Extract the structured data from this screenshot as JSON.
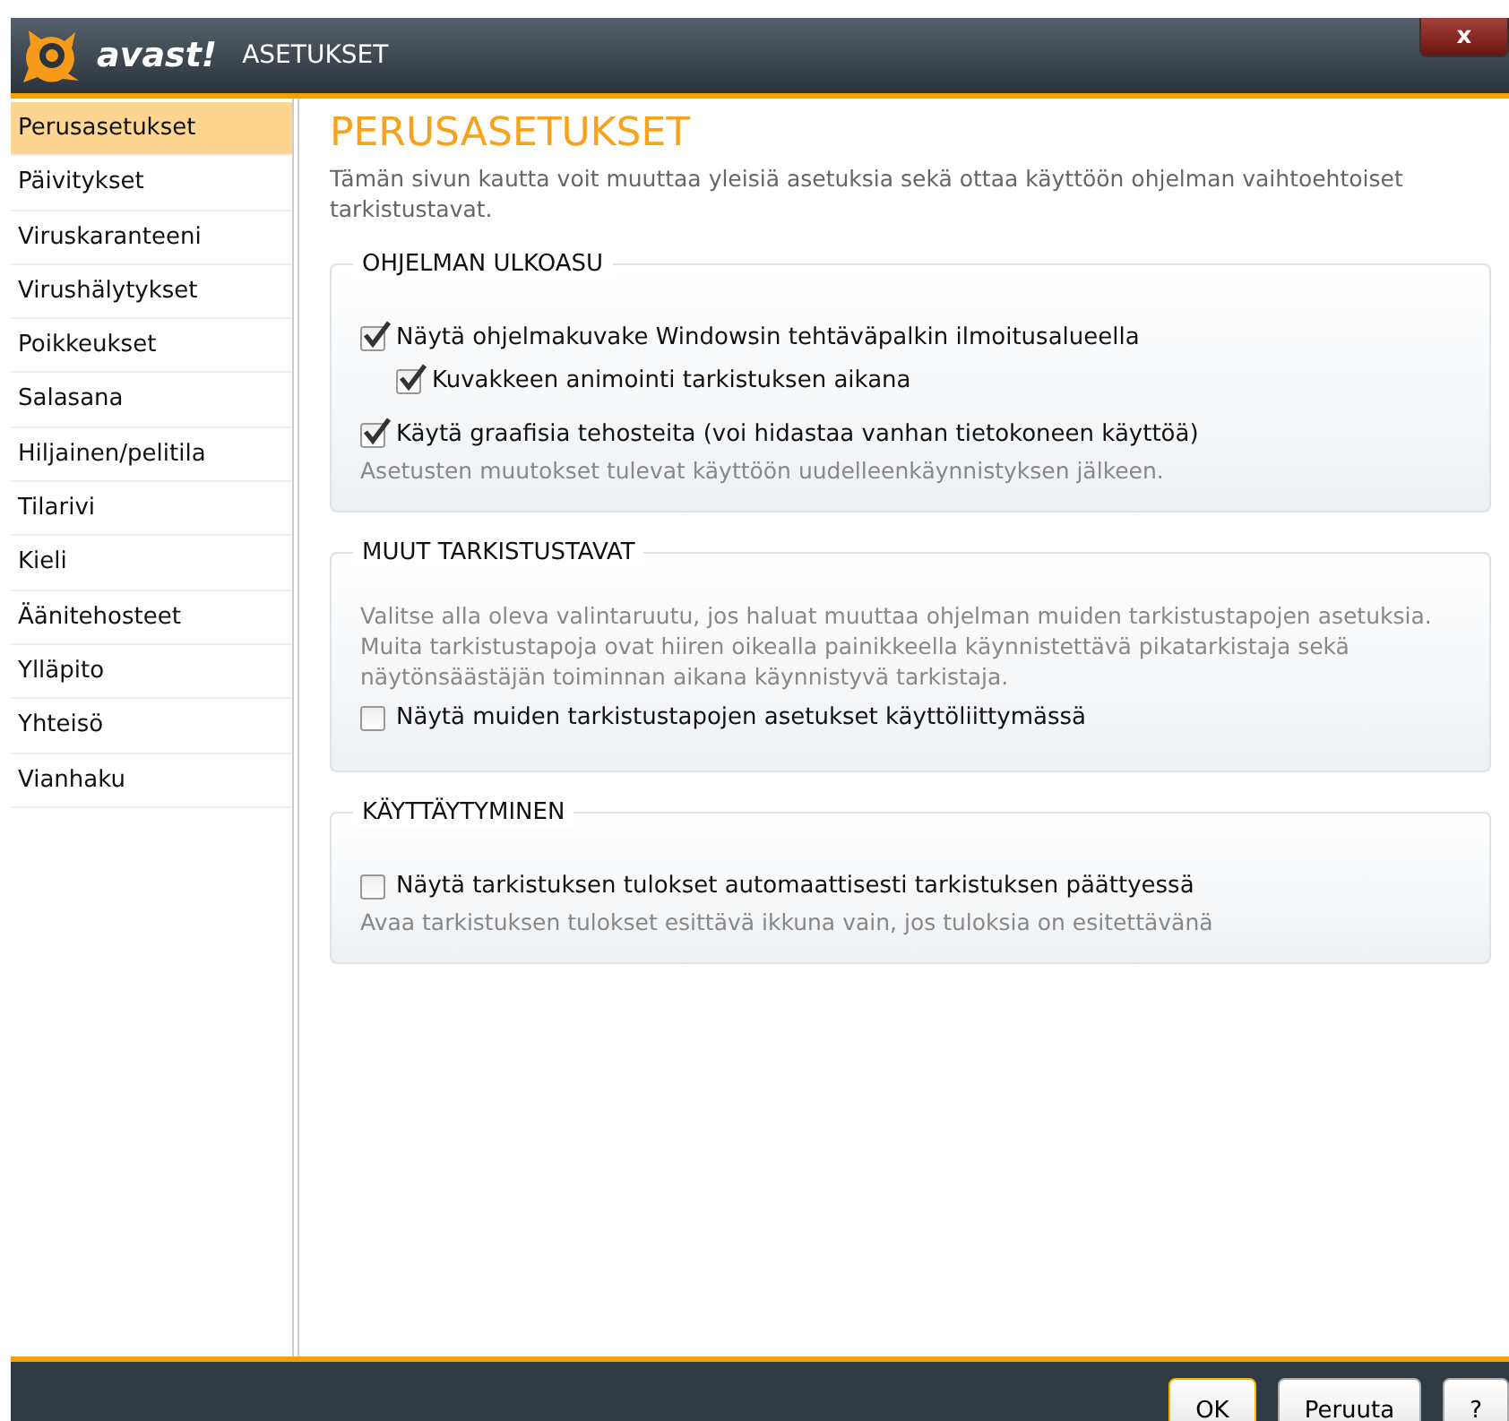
{
  "window": {
    "logo_text": "avast!",
    "title": "ASETUKSET",
    "close": "x"
  },
  "sidebar": {
    "items": [
      {
        "label": "Perusasetukset",
        "selected": true
      },
      {
        "label": "Päivitykset",
        "selected": false
      },
      {
        "label": "Viruskaranteeni",
        "selected": false
      },
      {
        "label": "Virushälytykset",
        "selected": false
      },
      {
        "label": "Poikkeukset",
        "selected": false
      },
      {
        "label": "Salasana",
        "selected": false
      },
      {
        "label": "Hiljainen/pelitila",
        "selected": false
      },
      {
        "label": "Tilarivi",
        "selected": false
      },
      {
        "label": "Kieli",
        "selected": false
      },
      {
        "label": "Äänitehosteet",
        "selected": false
      },
      {
        "label": "Ylläpito",
        "selected": false
      },
      {
        "label": "Yhteisö",
        "selected": false
      },
      {
        "label": "Vianhaku",
        "selected": false
      }
    ]
  },
  "page": {
    "heading": "PERUSASETUKSET",
    "description": "Tämän sivun kautta voit muuttaa yleisiä asetuksia sekä ottaa käyttöön ohjelman vaihtoehtoiset tarkistustavat.",
    "groups": [
      {
        "title": "OHJELMAN ULKOASU",
        "items": [
          {
            "kind": "checkbox",
            "label": "Näytä ohjelmakuvake Windowsin tehtäväpalkin ilmoitusalueella",
            "checked": true,
            "children": [
              {
                "kind": "checkbox",
                "label": "Kuvakkeen animointi tarkistuksen aikana",
                "checked": true
              }
            ]
          },
          {
            "kind": "checkbox",
            "label": "Käytä graafisia tehosteita (voi hidastaa vanhan tietokoneen käyttöä)",
            "checked": true
          },
          {
            "kind": "note",
            "label": "Asetusten muutokset tulevat käyttöön uudelleenkäynnistyksen jälkeen."
          }
        ]
      },
      {
        "title": "MUUT TARKISTUSTAVAT",
        "items": [
          {
            "kind": "note",
            "label": "Valitse alla oleva valintaruutu, jos haluat muuttaa ohjelman muiden tarkistustapojen asetuksia. Muita tarkistustapoja ovat hiiren oikealla painikkeella käynnistettävä pikatarkistaja sekä näytönsäästäjän toiminnan aikana käynnistyvä tarkistaja."
          },
          {
            "kind": "checkbox",
            "label": "Näytä muiden tarkistustapojen asetukset käyttöliittymässä",
            "checked": false
          }
        ]
      },
      {
        "title": "KÄYTTÄYTYMINEN",
        "items": [
          {
            "kind": "checkbox",
            "label": "Näytä tarkistuksen tulokset automaattisesti tarkistuksen päättyessä",
            "checked": false
          },
          {
            "kind": "note",
            "label": "Avaa tarkistuksen tulokset esittävä ikkuna vain, jos tuloksia on esitettävänä"
          }
        ]
      }
    ]
  },
  "buttons": [
    {
      "label": "OK",
      "default": true
    },
    {
      "label": "Peruuta",
      "default": false
    },
    {
      "label": "?",
      "default": false
    }
  ]
}
